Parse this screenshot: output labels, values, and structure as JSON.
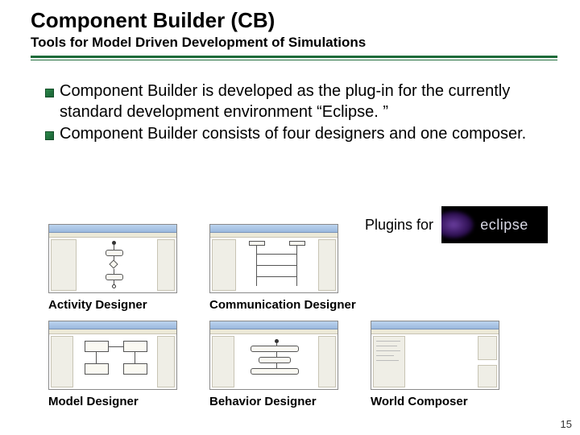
{
  "title": "Component Builder (CB)",
  "subtitle": "Tools for Model Driven Development of Simulations",
  "bullets": [
    "Component Builder is developed as the plug-in for the currently standard development environment “Eclipse. ”",
    "Component Builder consists of four designers and one composer."
  ],
  "plugins_label": "Plugins for",
  "eclipse_text": "eclipse",
  "captions": {
    "activity": "Activity Designer",
    "communication": "Communication Designer",
    "model": "Model Designer",
    "behavior": "Behavior Designer",
    "world": "World Composer"
  },
  "page_number": "15"
}
